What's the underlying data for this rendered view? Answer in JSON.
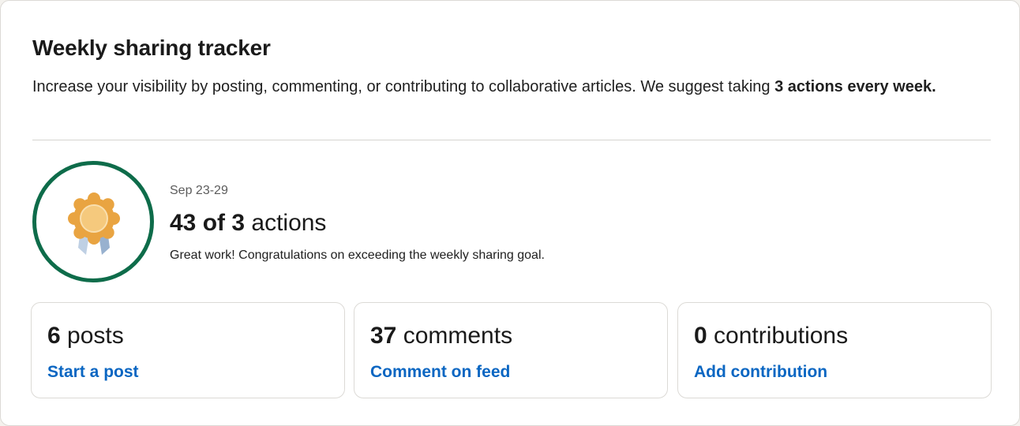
{
  "tracker": {
    "title": "Weekly sharing tracker",
    "description_pre": "Increase your visibility by posting, commenting, or contributing to collaborative articles. We suggest taking ",
    "description_bold": "3 actions every week."
  },
  "summary": {
    "week_range": "Sep 23-29",
    "actions_count": "43 of 3",
    "actions_suffix": " actions",
    "message": "Great work! Congratulations on exceeding the weekly sharing goal.",
    "badge_icon": "award-ribbon-icon",
    "badge_ring_color": "#0e6c4a"
  },
  "stats": [
    {
      "count": "6",
      "label": " posts",
      "action": "Start a post"
    },
    {
      "count": "37",
      "label": " comments",
      "action": "Comment on feed"
    },
    {
      "count": "0",
      "label": " contributions",
      "action": "Add contribution"
    }
  ],
  "colors": {
    "link": "#0a66c2",
    "badge_gold": "#e9a441",
    "badge_inner": "#f5c97d",
    "ribbon": "#a9bdd6"
  }
}
